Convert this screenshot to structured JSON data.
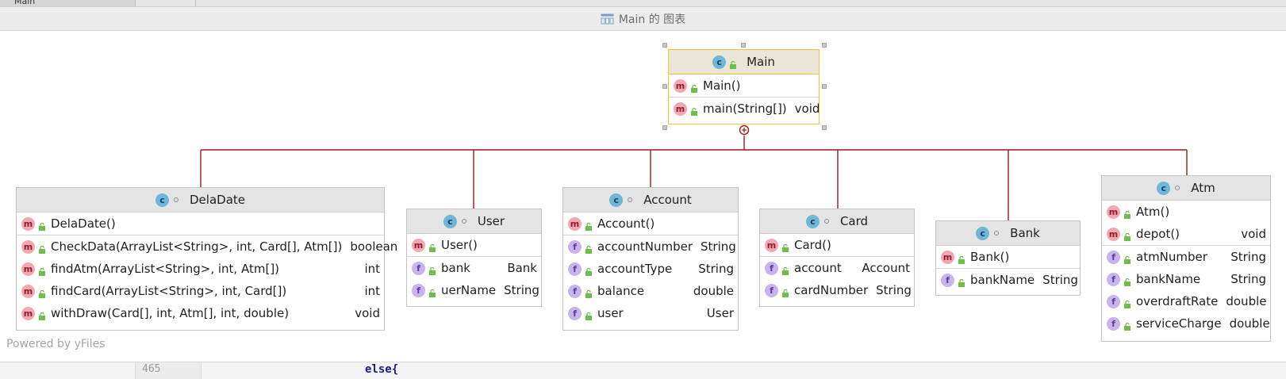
{
  "window": {
    "tab_label": "Main",
    "diagram_title": "Main 的 图表"
  },
  "colors": {
    "edge": "#a01818",
    "selection": "#f0c43a",
    "header_bg": "#e4e4e4"
  },
  "nodes": {
    "main": {
      "name": "Main",
      "members": [
        [
          {
            "kind": "method",
            "name": "Main()",
            "type": ""
          }
        ],
        [
          {
            "kind": "method",
            "name": "main(String[])",
            "type": "void"
          }
        ]
      ]
    },
    "deladate": {
      "name": "DelaDate",
      "members": [
        [
          {
            "kind": "method",
            "name": "DelaDate()",
            "type": ""
          }
        ],
        [
          {
            "kind": "method",
            "name": "CheckData(ArrayList<String>, int, Card[], Atm[])",
            "type": "boolean"
          },
          {
            "kind": "method",
            "name": "findAtm(ArrayList<String>, int, Atm[])",
            "type": "int"
          },
          {
            "kind": "method",
            "name": "findCard(ArrayList<String>, int, Card[])",
            "type": "int"
          },
          {
            "kind": "method",
            "name": "withDraw(Card[], int, Atm[], int, double)",
            "type": "void"
          }
        ]
      ]
    },
    "user": {
      "name": "User",
      "members": [
        [
          {
            "kind": "method",
            "name": "User()",
            "type": ""
          }
        ],
        [
          {
            "kind": "field",
            "name": "bank",
            "type": "Bank"
          },
          {
            "kind": "field",
            "name": "uerName",
            "type": "String"
          }
        ]
      ]
    },
    "account": {
      "name": "Account",
      "members": [
        [
          {
            "kind": "method",
            "name": "Account()",
            "type": ""
          }
        ],
        [
          {
            "kind": "field",
            "name": "accountNumber",
            "type": "String"
          },
          {
            "kind": "field",
            "name": "accountType",
            "type": "String"
          },
          {
            "kind": "field",
            "name": "balance",
            "type": "double"
          },
          {
            "kind": "field",
            "name": "user",
            "type": "User"
          }
        ]
      ]
    },
    "card": {
      "name": "Card",
      "members": [
        [
          {
            "kind": "method",
            "name": "Card()",
            "type": ""
          }
        ],
        [
          {
            "kind": "field",
            "name": "account",
            "type": "Account"
          },
          {
            "kind": "field",
            "name": "cardNumber",
            "type": "String"
          }
        ]
      ]
    },
    "bank": {
      "name": "Bank",
      "members": [
        [
          {
            "kind": "method",
            "name": "Bank()",
            "type": ""
          }
        ],
        [
          {
            "kind": "field",
            "name": "bankName",
            "type": "String"
          }
        ]
      ]
    },
    "atm": {
      "name": "Atm",
      "members": [
        [
          {
            "kind": "method",
            "name": "Atm()",
            "type": ""
          },
          {
            "kind": "method",
            "name": "depot()",
            "type": "void"
          }
        ],
        [
          {
            "kind": "field",
            "name": "atmNumber",
            "type": "String"
          },
          {
            "kind": "field",
            "name": "bankName",
            "type": "String"
          },
          {
            "kind": "field",
            "name": "overdraftRate",
            "type": "double"
          },
          {
            "kind": "field",
            "name": "serviceCharge",
            "type": "double"
          }
        ]
      ]
    }
  },
  "watermark": "Powered by yFiles",
  "editor_behind": {
    "line_number": "465",
    "code_text": "else{"
  }
}
